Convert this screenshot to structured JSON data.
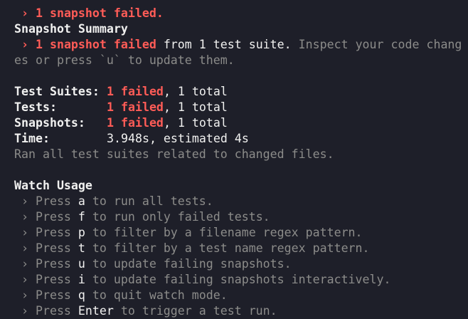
{
  "failure_header": {
    "arrow": " › ",
    "text": "1 snapshot failed."
  },
  "snapshot_summary": {
    "title": "Snapshot Summary",
    "arrow": " › ",
    "failed_text": "1 snapshot failed",
    "from_text": " from 1 test suite. ",
    "hint_line1": "Inspect your code chang",
    "hint_line2": "es or press `u` to update them."
  },
  "results": {
    "suites_label": "Test Suites:",
    "suites_failed": "1 failed",
    "suites_total": ", 1 total",
    "tests_label": "Tests:",
    "tests_failed": "1 failed",
    "tests_total": ", 1 total",
    "snapshots_label": "Snapshots:",
    "snapshots_failed": "1 failed",
    "snapshots_total": ", 1 total",
    "time_label": "Time:",
    "time_value": "3.948s, estimated 4s",
    "ran_note": "Ran all test suites related to changed files."
  },
  "watch_usage": {
    "title": "Watch Usage",
    "items": [
      {
        "arrow": " › Press ",
        "key": "a",
        "desc": " to run all tests."
      },
      {
        "arrow": " › Press ",
        "key": "f",
        "desc": " to run only failed tests."
      },
      {
        "arrow": " › Press ",
        "key": "p",
        "desc": " to filter by a filename regex pattern."
      },
      {
        "arrow": " › Press ",
        "key": "t",
        "desc": " to filter by a test name regex pattern."
      },
      {
        "arrow": " › Press ",
        "key": "u",
        "desc": " to update failing snapshots."
      },
      {
        "arrow": " › Press ",
        "key": "i",
        "desc": " to update failing snapshots interactively."
      },
      {
        "arrow": " › Press ",
        "key": "q",
        "desc": " to quit watch mode."
      },
      {
        "arrow": " › Press ",
        "key": "Enter",
        "desc": " to trigger a test run."
      }
    ]
  },
  "colors": {
    "background": "#1e1f29",
    "foreground": "#f1f1f0",
    "error": "#ff5c57",
    "dim": "#8c8c8a"
  }
}
